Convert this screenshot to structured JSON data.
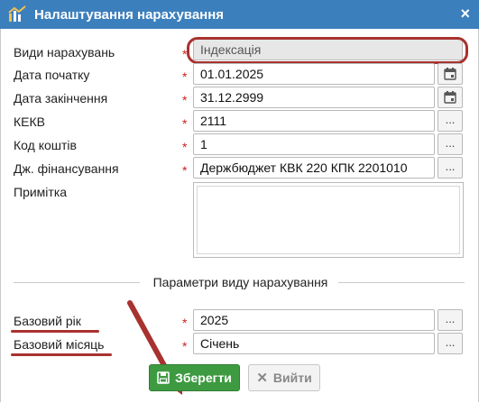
{
  "window": {
    "title": "Налаштування нарахування",
    "close_symbol": "×",
    "app_icon": "chart-logo-icon"
  },
  "form": {
    "accrual_type": {
      "label": "Види нарахувань",
      "value": "Індексація",
      "required_mark": "*"
    },
    "start_date": {
      "label": "Дата початку",
      "value": "01.01.2025",
      "required_mark": "*"
    },
    "end_date": {
      "label": "Дата закінчення",
      "value": "31.12.2999",
      "required_mark": "*"
    },
    "kekv": {
      "label": "КЕКВ",
      "value": "2111",
      "required_mark": "*",
      "button": "..."
    },
    "fund_code": {
      "label": "Код коштів",
      "value": "1",
      "required_mark": "*",
      "button": "..."
    },
    "financing_source": {
      "label": "Дж. фінансування",
      "value": "Держбюджет КВК 220 КПК 2201010",
      "required_mark": "*",
      "button": "..."
    },
    "note": {
      "label": "Примітка",
      "value": ""
    }
  },
  "params_section": {
    "title": "Параметри виду нарахування",
    "base_year": {
      "label": "Базовий рік",
      "value": "2025",
      "required_mark": "*",
      "button": "..."
    },
    "base_month": {
      "label": "Базовий місяць",
      "value": "Січень",
      "required_mark": "*",
      "button": "..."
    }
  },
  "buttons": {
    "save": "Зберегти",
    "exit": "Вийти"
  },
  "colors": {
    "titlebar": "#3c7fbd",
    "save": "#3e9a41",
    "annotation": "#a8322f",
    "required": "#d02020"
  }
}
